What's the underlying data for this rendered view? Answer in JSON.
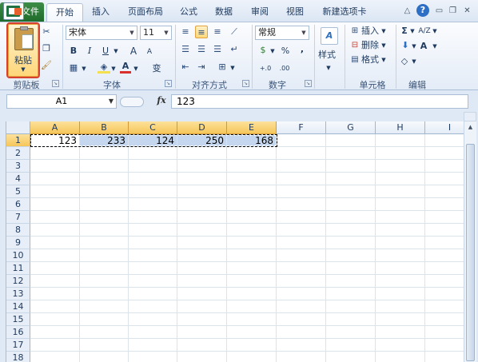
{
  "tabs": {
    "file": "文件",
    "home": "开始",
    "insert": "插入",
    "layout": "页面布局",
    "formulas": "公式",
    "data": "数据",
    "review": "审阅",
    "view": "视图",
    "new_tab": "新建选项卡"
  },
  "window_controls": {
    "minimize_ribbon": "△",
    "help": "?",
    "minimize": "▭",
    "restore": "❐",
    "close": "✕"
  },
  "clipboard": {
    "paste_label": "粘贴",
    "group_label": "剪贴板",
    "cut_icon": "scissors-icon",
    "copy_icon": "copy-icon",
    "format_painter_icon": "format-painter-icon"
  },
  "font": {
    "font_name": "宋体",
    "font_size": "11",
    "bold": "B",
    "italic": "I",
    "underline": "U",
    "grow": "A",
    "shrink": "A",
    "font_color_letter": "A",
    "phonetic": "变",
    "group_label": "字体",
    "font_color": "#d9302c",
    "fill_color": "#f4e04d"
  },
  "alignment": {
    "group_label": "对齐方式",
    "wrap_icon": "wrap-text-icon",
    "merge_icon": "merge-cells-icon"
  },
  "number": {
    "format": "常规",
    "percent": "%",
    "comma": ",",
    "group_label": "数字",
    "currency_icon": "currency-icon",
    "increase_decimal": "+.0",
    "decrease_decimal": ".00"
  },
  "styles": {
    "label": "样式"
  },
  "cells": {
    "insert": "插入",
    "delete": "删除",
    "format": "格式",
    "group_label": "单元格"
  },
  "editing": {
    "sum": "Σ",
    "sort": "A/Z",
    "find": "A",
    "clear": "◇",
    "group_label": "编辑"
  },
  "formula_bar": {
    "name_box": "A1",
    "fx": "fx",
    "content": "123"
  },
  "grid": {
    "columns": [
      "A",
      "B",
      "C",
      "D",
      "E",
      "F",
      "G",
      "H",
      "I"
    ],
    "rows": [
      "1",
      "2",
      "3",
      "4",
      "5",
      "6",
      "7",
      "8",
      "9",
      "10",
      "11",
      "12",
      "13",
      "14",
      "15",
      "16",
      "17",
      "18"
    ],
    "row1_values": [
      "123",
      "233",
      "124",
      "250",
      "168"
    ],
    "selection": "A1:E1"
  }
}
